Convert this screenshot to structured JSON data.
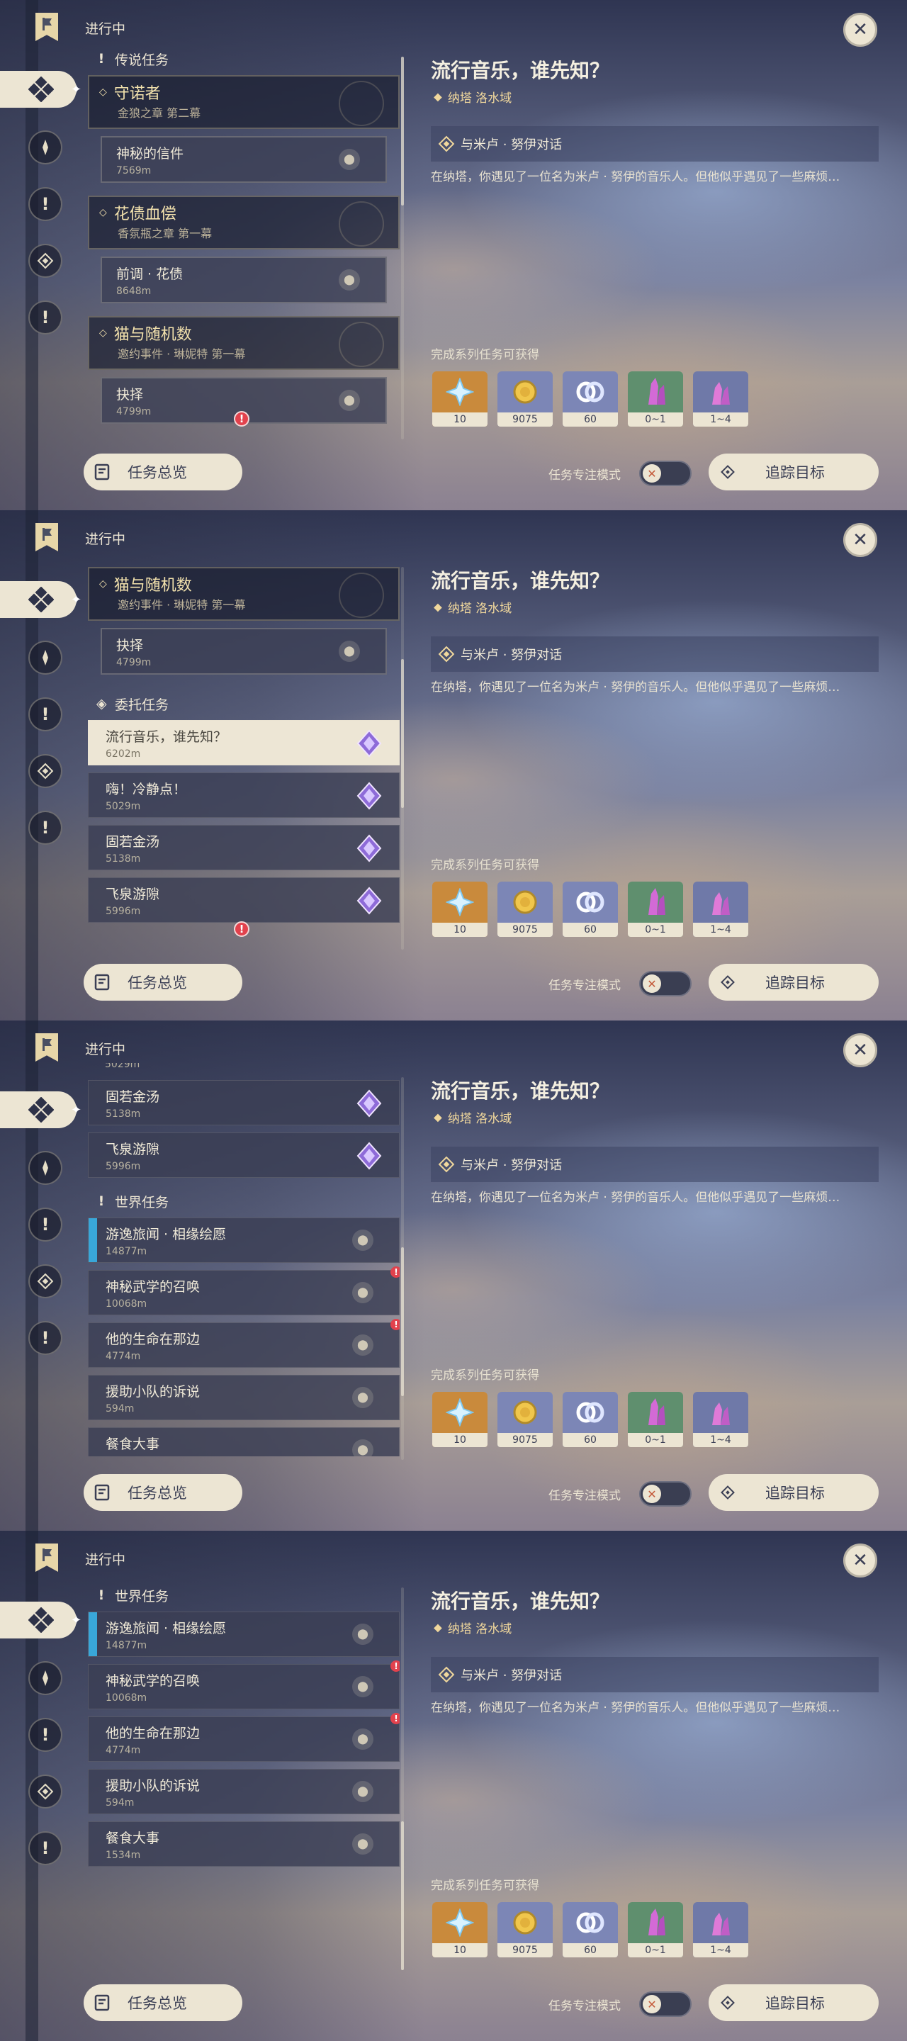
{
  "header": {
    "status": "进行中",
    "close_label": "✕"
  },
  "detail": {
    "title": "流行音乐，谁先知？",
    "location": "纳塔 洛水域",
    "step": "与米卢 · 努伊对话",
    "description": "在纳塔，你遇见了一位名为米卢 · 努伊的音乐人。但他似乎遇见了一些麻烦…",
    "rewards_title": "完成系列任务可获得",
    "rewards": [
      {
        "name": "primogem-icon",
        "count": "10",
        "bg": "#c98a3c"
      },
      {
        "name": "mora-icon",
        "count": "9075",
        "bg": "#7c86b6"
      },
      {
        "name": "fate-icon",
        "count": "60",
        "bg": "#7c86b6"
      },
      {
        "name": "crystal-green-icon",
        "count": "0~1",
        "bg": "#5f8f6e"
      },
      {
        "name": "crystal-purple-icon",
        "count": "1~4",
        "bg": "#6f79a8"
      }
    ]
  },
  "bottom": {
    "overview_label": "任务总览",
    "focus_label": "任务专注模式",
    "track_label": "追踪目标"
  },
  "sections": {
    "legend": "传说任务",
    "commission": "委托任务",
    "world": "世界任务"
  },
  "legend": [
    {
      "title": "守诺者",
      "sub": "金狼之章 第二幕",
      "task": "神秘的信件",
      "dist": "7569m"
    },
    {
      "title": "花债血偿",
      "sub": "香氛瓶之章 第一幕",
      "task": "前调 · 花债",
      "dist": "8648m"
    },
    {
      "title": "猫与随机数",
      "sub": "邀约事件 · 琳妮特 第一幕",
      "task": "抉择",
      "dist": "4799m"
    }
  ],
  "commission": [
    {
      "name": "流行音乐，谁先知？",
      "dist": "6202m"
    },
    {
      "name": "嗨！冷静点！",
      "dist": "5029m"
    },
    {
      "name": "固若金汤",
      "dist": "5138m"
    },
    {
      "name": "飞泉游隙",
      "dist": "5996m"
    }
  ],
  "world": [
    {
      "name": "游逸旅闻 · 相缘绘愿",
      "dist": "14877m"
    },
    {
      "name": "神秘武学的召唤",
      "dist": "10068m"
    },
    {
      "name": "他的生命在那边",
      "dist": "4774m"
    },
    {
      "name": "援助小队的诉说",
      "dist": "594m"
    },
    {
      "name": "餐食大事",
      "dist": "1534m"
    }
  ],
  "fragment_dist": "5029m"
}
